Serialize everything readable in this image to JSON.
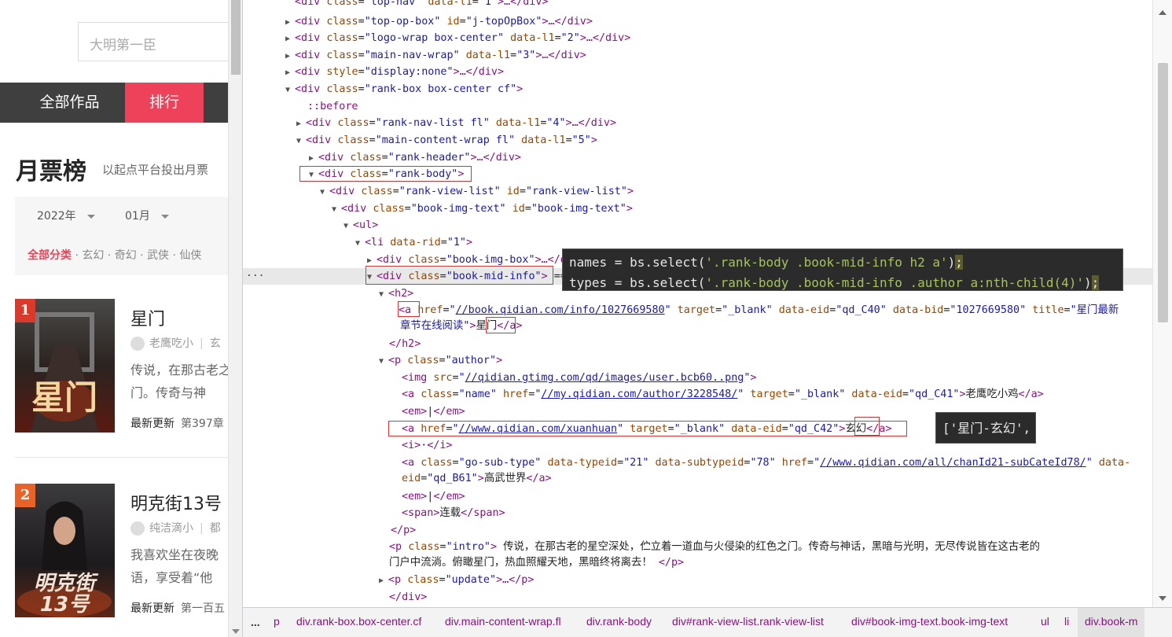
{
  "site": {
    "search_placeholder": "大明第一臣",
    "nav": {
      "all": "全部作品",
      "rank": "排行"
    },
    "rank_title": "月票榜",
    "rank_subtitle": "以起点平台投出月票",
    "filter": {
      "year": "2022年",
      "month": "01月"
    },
    "categories": {
      "active": "全部分类",
      "rest": "· 玄幻 · 奇幻 · 武侠 · 仙侠"
    },
    "books": [
      {
        "rank": "1",
        "name": "星门",
        "author": "老鹰吃小",
        "type": "玄",
        "intro": "传说，在那古老之门。传奇与神",
        "update_label": "最新更新",
        "update_chapter": "第397章",
        "rank_color": "#d93a2b"
      },
      {
        "rank": "2",
        "name": "明克街13号",
        "author": "纯洁滴小",
        "type": "都",
        "intro": "我喜欢坐在夜晚语，享受着“他",
        "update_label": "最新更新",
        "update_chapter": "第一百五",
        "rank_color": "#e8622a"
      }
    ]
  },
  "devtools": {
    "more_dots": "...",
    "lines": {
      "l1_a": "div",
      "l1_b": "class",
      "l1_c": "\"top-nav\"",
      "l1_d": "data-l1",
      "l1_e": "\"1\"",
      "l1_f": ">…</div>",
      "topop_cls": "\"top-op-box\"",
      "topop_id": "\"j-topOpBox\"",
      "logo_cls": "\"logo-wrap box-center\"",
      "logo_l1": "\"2\"",
      "mainnav_cls": "\"main-nav-wrap\"",
      "mainnav_l1": "\"3\"",
      "style_val": "\"display:none\"",
      "rankbox_cls": "\"rank-box box-center cf\"",
      "before": "::before",
      "ranknav_cls": "\"rank-nav-list fl\"",
      "ranknav_l1": "\"4\"",
      "maincw_cls": "\"main-content-wrap fl\"",
      "maincw_l1": "\"5\"",
      "rankheader_cls": "\"rank-header\"",
      "rankbody_cls": "\"rank-body\"",
      "rvl_cls": "\"rank-view-list\"",
      "rvl_id": "\"rank-view-list\"",
      "bit_cls": "\"book-img-text\"",
      "bit_id": "\"book-img-text\"",
      "li_rid": "\"1\"",
      "bib_cls": "\"book-img-box\"",
      "bmi_cls": "\"book-mid-info\"",
      "a_href": "//book.qidian.com/info/1027669580",
      "a_target": "\"_blank\"",
      "a_eid": "\"qd_C40\"",
      "a_bid": "\"1027669580\"",
      "a_title": "\"星门最新",
      "a_title2": "章节在线阅读\"",
      "a_text": "星门",
      "author_cls": "\"author\"",
      "img_src": "//qidian.gtimg.com/qd/images/user.bcb60..png",
      "name_cls": "\"name\"",
      "name_href": "//my.qidian.com/author/3228548/",
      "name_target": "\"_blank\"",
      "name_eid": "\"qd_C41\"",
      "name_text": "老鹰吃小鸡",
      "em_text": "|",
      "xh_href": "//www.qidian.com/xuanhuan",
      "xh_target": "\"_blank\"",
      "xh_eid": "\"qd_C42\"",
      "xh_text": "玄幻",
      "i_text": "·",
      "gst_cls": "\"go-sub-type\"",
      "gst_type": "\"21\"",
      "gst_sub": "\"78\"",
      "gst_href": "//www.qidian.com/all/chanId21-subCateId78/",
      "gst_eid": "\"qd_B61\"",
      "gst_text": "高武世界",
      "span_text": "连载",
      "intro_cls": "\"intro\"",
      "intro_text": " 传说，在那古老的星空深处，伫立着一道血与火侵染的红色之门。传奇与神话，黑暗与光明，无尽传说皆在这古老的",
      "intro_text2": "门户中流淌。俯瞰星门，热血照耀天地，黑暗终将离去！ ",
      "update_cls": "\"update\""
    },
    "tooltip1": {
      "l1_pre": "names = bs.select(",
      "l1_str": "'.rank-body .book-mid-info h2 a'",
      "l1_post": ")",
      "l2_pre": "types = bs.select(",
      "l2_str": "'.rank-body .book-mid-info .author a:nth-child(4)'",
      "l2_post": ")",
      "semi": ";"
    },
    "tooltip2": {
      "text": "['星门-玄幻',"
    },
    "breadcrumbs": {
      "more": "...",
      "c0": "p",
      "c1_tag": "div",
      "c1_cls": ".rank-box.box-center.cf",
      "c2_tag": "div",
      "c2_cls": ".main-content-wrap.fl",
      "c3_tag": "div",
      "c3_cls": ".rank-body",
      "c4_tag": "div",
      "c4_cls": "#rank-view-list.rank-view-list",
      "c5_tag": "div",
      "c5_cls": "#book-img-text.book-img-text",
      "c6": "ul",
      "c7": "li",
      "c8": "div.book-m"
    }
  }
}
